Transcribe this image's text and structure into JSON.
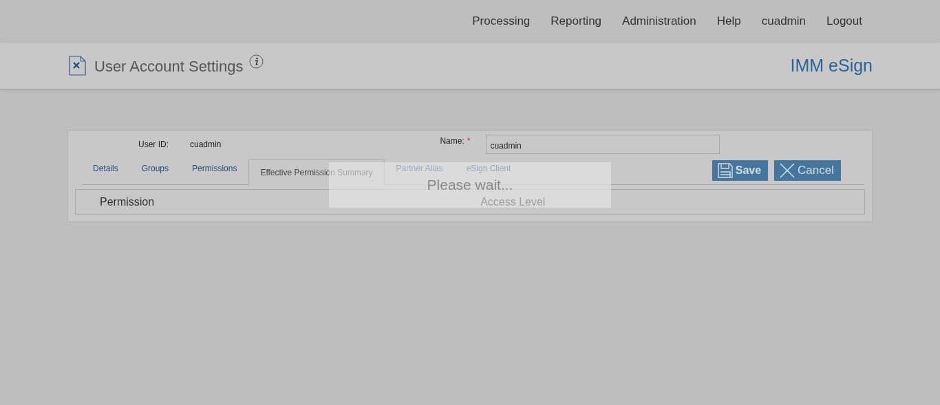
{
  "nav": {
    "items": [
      {
        "label": "Processing"
      },
      {
        "label": "Reporting"
      },
      {
        "label": "Administration"
      },
      {
        "label": "Help"
      },
      {
        "label": "cuadmin"
      },
      {
        "label": "Logout"
      }
    ]
  },
  "header": {
    "title": "User Account Settings",
    "brand": "IMM eSign"
  },
  "form": {
    "user_id_label": "User ID:",
    "user_id": "cuadmin",
    "name_label": "Name:",
    "name_required": true,
    "required_mark": "*",
    "name_value": "cuadmin"
  },
  "tabs": [
    {
      "label": "Details",
      "selected": false
    },
    {
      "label": "Groups",
      "selected": false
    },
    {
      "label": "Permissions",
      "selected": false
    },
    {
      "label": "Effective Permission Summary",
      "selected": true
    },
    {
      "label": "Partner Alias",
      "selected": false
    },
    {
      "label": "eSign Client",
      "selected": false
    }
  ],
  "buttons": [
    {
      "kind": "save",
      "label": "Save"
    },
    {
      "kind": "cancel",
      "label": "Cancel"
    }
  ],
  "table": {
    "columns": [
      "Permission",
      "Access Level"
    ]
  },
  "loading": {
    "message": "Please wait..."
  }
}
